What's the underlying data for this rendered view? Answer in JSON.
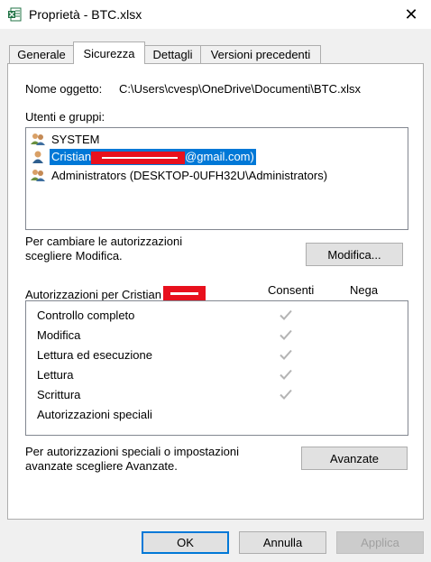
{
  "window": {
    "title": "Proprietà - BTC.xlsx",
    "close": "✕"
  },
  "tabs": [
    {
      "label": "Generale",
      "active": false
    },
    {
      "label": "Sicurezza",
      "active": true
    },
    {
      "label": "Dettagli",
      "active": false
    },
    {
      "label": "Versioni precedenti",
      "active": false
    }
  ],
  "object": {
    "label": "Nome oggetto:",
    "path": "C:\\Users\\cvesp\\OneDrive\\Documenti\\BTC.xlsx"
  },
  "groups": {
    "label": "Utenti e gruppi:",
    "items": [
      {
        "prefix": "SYSTEM",
        "suffix": "",
        "icon": "users-group-icon",
        "selected": false
      },
      {
        "prefix": "Cristian",
        "suffix": "@gmail.com)",
        "icon": "user-icon",
        "selected": true
      },
      {
        "prefix": "Administrators (DESKTOP-0UFH32U\\Administrators)",
        "suffix": "",
        "icon": "users-group-icon",
        "selected": false
      }
    ]
  },
  "change": {
    "line1": "Per cambiare le autorizzazioni",
    "line2": "scegliere Modifica.",
    "button": "Modifica..."
  },
  "permissions": {
    "header": "Autorizzazioni per Cristian",
    "allow": "Consenti",
    "deny": "Nega",
    "rows": [
      {
        "name": "Controllo completo",
        "allow": true,
        "deny": false
      },
      {
        "name": "Modifica",
        "allow": true,
        "deny": false
      },
      {
        "name": "Lettura ed esecuzione",
        "allow": true,
        "deny": false
      },
      {
        "name": "Lettura",
        "allow": true,
        "deny": false
      },
      {
        "name": "Scrittura",
        "allow": true,
        "deny": false
      },
      {
        "name": "Autorizzazioni speciali",
        "allow": false,
        "deny": false
      }
    ]
  },
  "advanced": {
    "line1": "Per autorizzazioni speciali o impostazioni",
    "line2": "avanzate scegliere Avanzate.",
    "button": "Avanzate"
  },
  "footer": {
    "ok": "OK",
    "cancel": "Annulla",
    "apply": "Applica"
  },
  "colors": {
    "selection": "#0078d7",
    "redaction": "#e8101d",
    "check": "#b4b4b4"
  }
}
